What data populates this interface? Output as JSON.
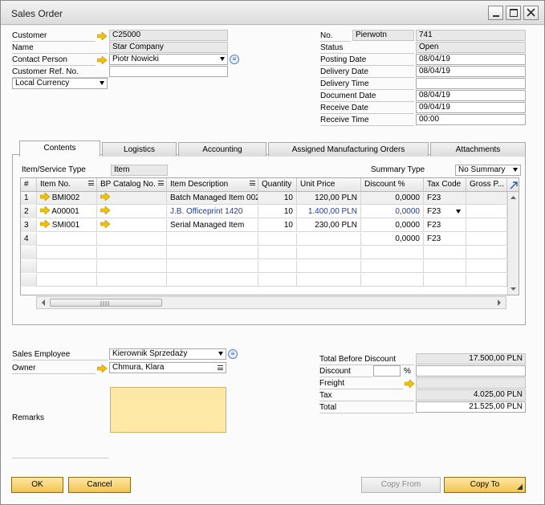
{
  "window": {
    "title": "Sales Order"
  },
  "header_left": {
    "customer": {
      "label": "Customer",
      "value": "C25000"
    },
    "name": {
      "label": "Name",
      "value": "Star Company"
    },
    "contact_person": {
      "label": "Contact Person",
      "value": "Piotr Nowicki"
    },
    "customer_ref": {
      "label": "Customer Ref. No.",
      "value": ""
    },
    "currency": {
      "value": "Local Currency"
    }
  },
  "header_right": {
    "no": {
      "label": "No.",
      "series": "Pierwotn",
      "value": "741"
    },
    "status": {
      "label": "Status",
      "value": "Open"
    },
    "posting_date": {
      "label": "Posting Date",
      "value": "08/04/19"
    },
    "delivery_date": {
      "label": "Delivery Date",
      "value": "08/04/19"
    },
    "delivery_time": {
      "label": "Delivery Time",
      "value": ""
    },
    "document_date": {
      "label": "Document Date",
      "value": "08/04/19"
    },
    "receive_date": {
      "label": "Receive Date",
      "value": "09/04/19"
    },
    "receive_time": {
      "label": "Receive Time",
      "value": "00:00"
    }
  },
  "tabs": [
    {
      "label": "Contents"
    },
    {
      "label": "Logistics"
    },
    {
      "label": "Accounting"
    },
    {
      "label": "Assigned Manufacturing Orders"
    },
    {
      "label": "Attachments"
    }
  ],
  "contents": {
    "item_type_label": "Item/Service Type",
    "item_type_value": "Item",
    "summary_type_label": "Summary Type",
    "summary_type_value": "No Summary",
    "columns": [
      "#",
      "Item No.",
      "BP Catalog No.",
      "Item Description",
      "Quantity",
      "Unit Price",
      "Discount %",
      "Tax Code",
      "Gross P..."
    ],
    "rows": [
      {
        "n": "1",
        "item": "BMI002",
        "desc": "Batch Managed Item 002",
        "qty": "10",
        "price": "120,00 PLN",
        "disc": "0,0000",
        "tax": "F23"
      },
      {
        "n": "2",
        "item": "A00001",
        "desc": "J.B. Officeprint 1420",
        "qty": "10",
        "price": "1.400,00 PLN",
        "disc": "0,0000",
        "tax": "F23"
      },
      {
        "n": "3",
        "item": "SMI001",
        "desc": "Serial Managed Item",
        "qty": "10",
        "price": "230,00 PLN",
        "disc": "0,0000",
        "tax": "F23"
      },
      {
        "n": "4",
        "item": "",
        "desc": "",
        "qty": "",
        "price": "",
        "disc": "0,0000",
        "tax": "F23"
      }
    ]
  },
  "footer_left": {
    "sales_employee": {
      "label": "Sales Employee",
      "value": "Kierownik Sprzedaży"
    },
    "owner": {
      "label": "Owner",
      "value": "Chmura, Klara"
    },
    "remarks": {
      "label": "Remarks",
      "value": ""
    }
  },
  "totals": {
    "total_before_discount": {
      "label": "Total Before Discount",
      "value": "17.500,00 PLN"
    },
    "discount": {
      "label": "Discount",
      "percent": "",
      "percent_sign": "%",
      "value": ""
    },
    "freight": {
      "label": "Freight",
      "value": ""
    },
    "tax": {
      "label": "Tax",
      "value": "4.025,00 PLN"
    },
    "total": {
      "label": "Total",
      "value": "21.525,00 PLN"
    }
  },
  "buttons": {
    "ok": "OK",
    "cancel": "Cancel",
    "copy_from": "Copy From",
    "copy_to": "Copy To"
  },
  "colors": {
    "button_gold": "#f4c351",
    "remarks_bg": "#fde9a5",
    "link_arrow": "#f2c200",
    "blue_text": "#1f3d99"
  }
}
